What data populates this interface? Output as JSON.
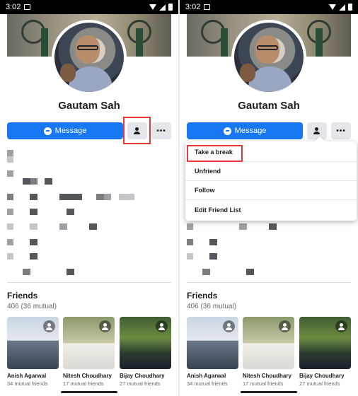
{
  "status_bar": {
    "time": "3:02"
  },
  "profile": {
    "name": "Gautam Sah",
    "message_label": "Message",
    "more_label": "•••"
  },
  "friends": {
    "title": "Friends",
    "count": "406 (36 mutual)",
    "items": [
      {
        "name": "Anish Agarwal",
        "mutual": "34 mutual friends"
      },
      {
        "name": "Nitesh Choudhary",
        "mutual": "17 mutual friends"
      },
      {
        "name": "Bijay Choudhary",
        "mutual": "27 mutual friends"
      }
    ]
  },
  "friend_menu": {
    "items": [
      "Take a break",
      "Unfriend",
      "Follow",
      "Edit Friend List"
    ]
  },
  "colors": {
    "accent": "#1877f2",
    "highlight": "#e53935"
  },
  "icons": [
    "messenger-icon",
    "person-icon",
    "more-icon",
    "add-friend-icon",
    "wifi-icon",
    "signal-icon",
    "battery-icon",
    "image-icon"
  ]
}
